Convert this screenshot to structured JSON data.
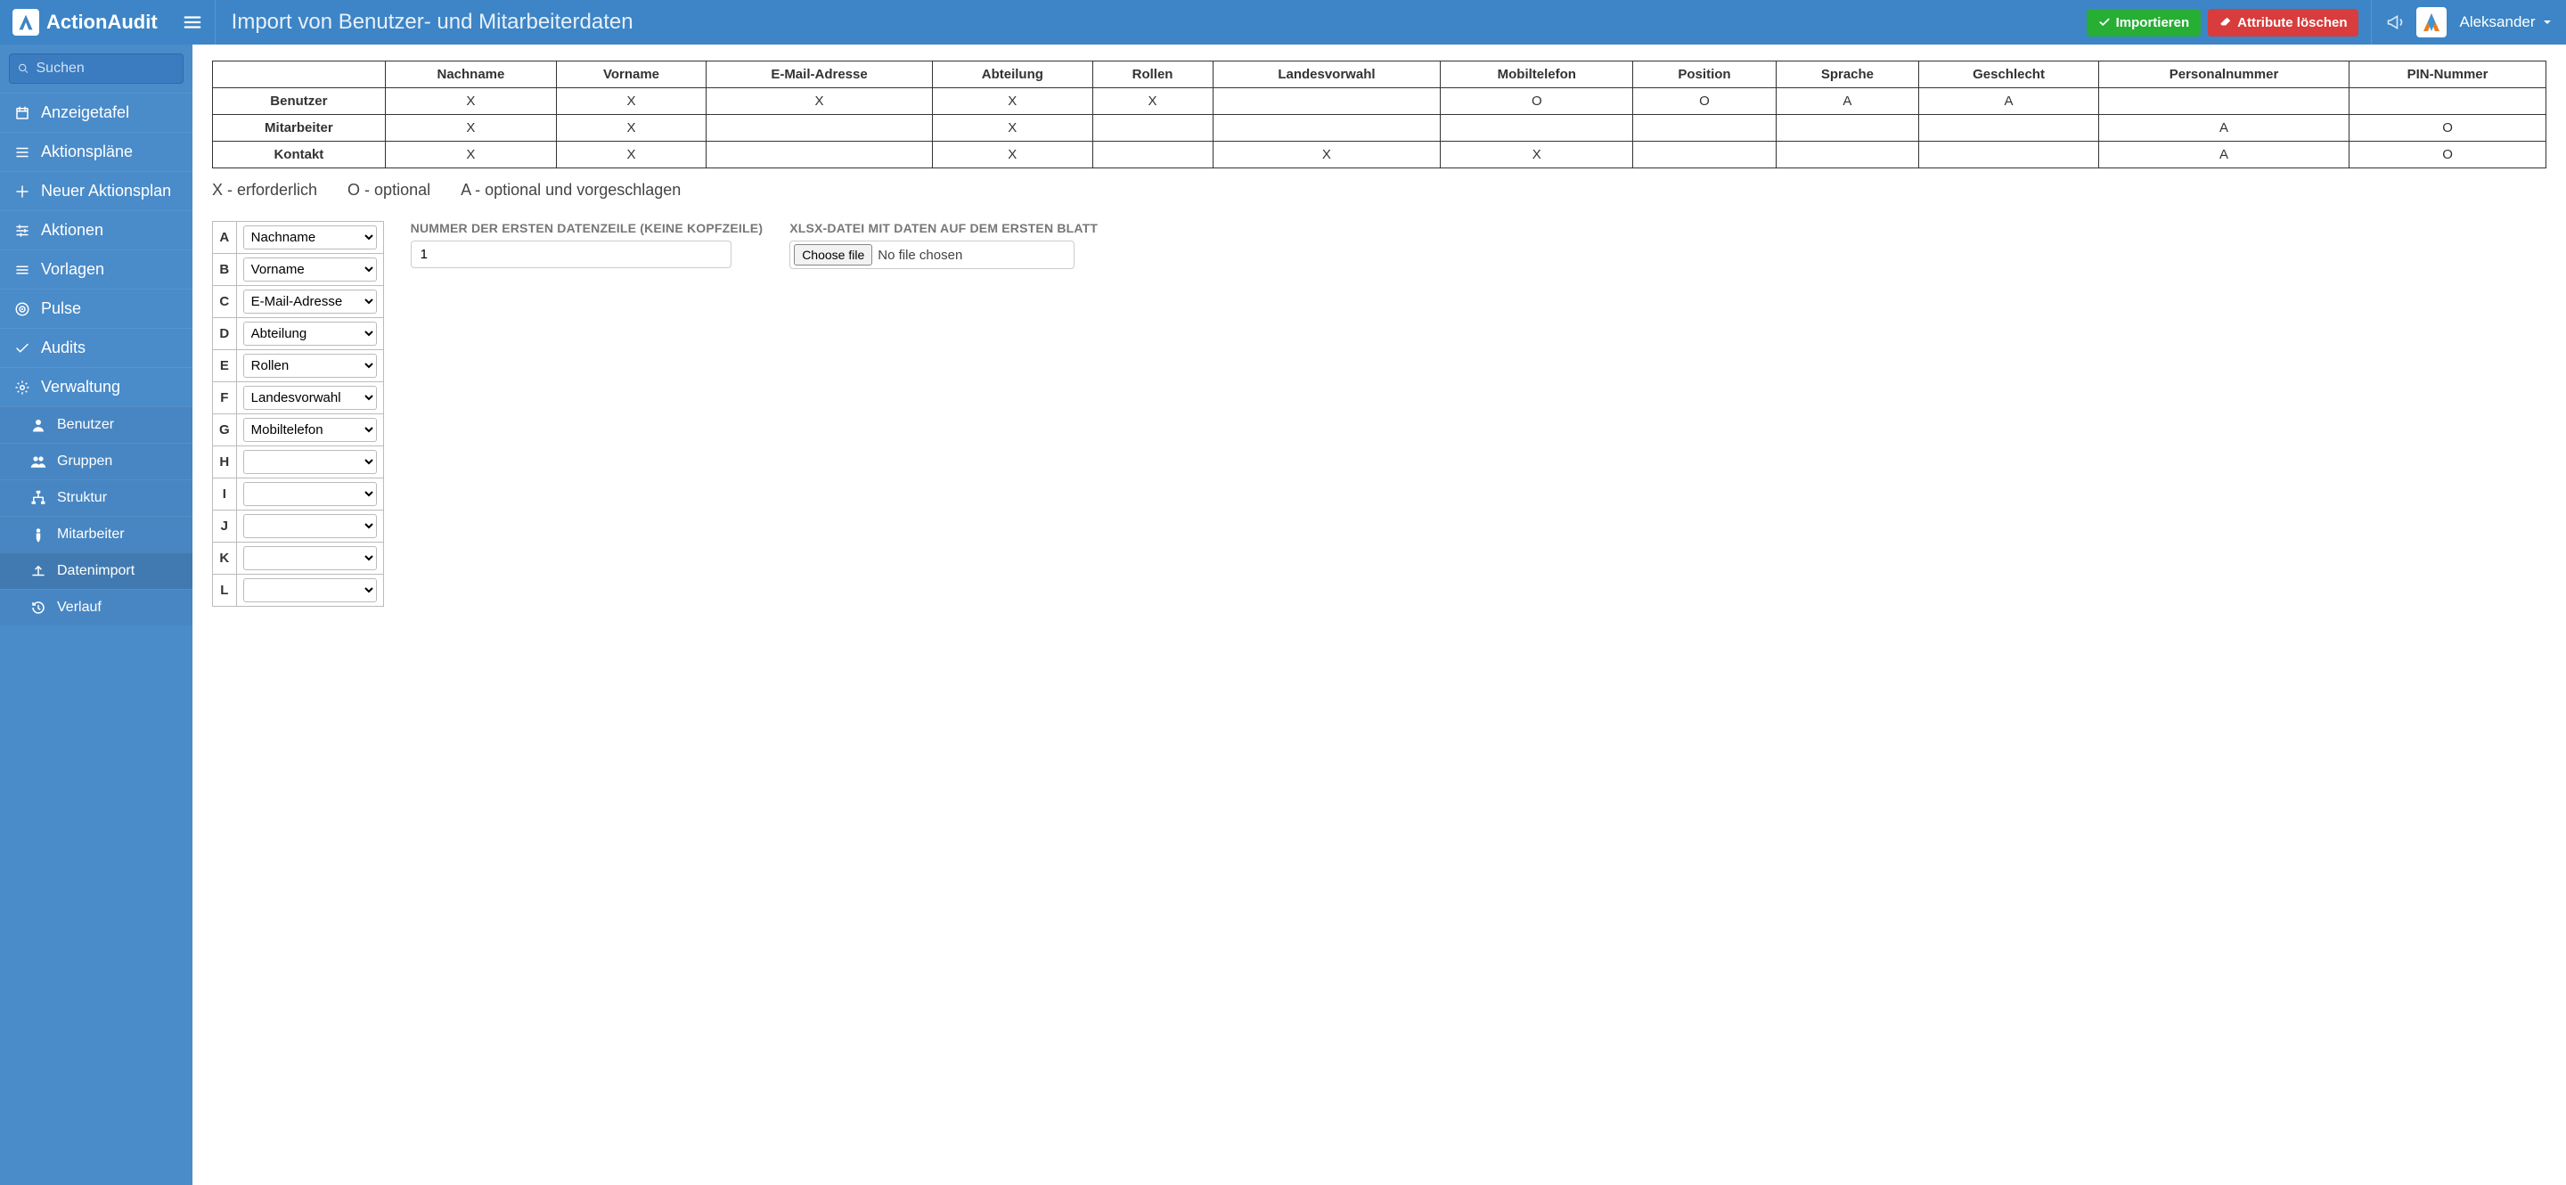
{
  "brand": {
    "name": "ActionAudit"
  },
  "page_title": "Import von Benutzer- und Mitarbeiterdaten",
  "top_actions": {
    "import": "Importieren",
    "clear": "Attribute löschen"
  },
  "user": {
    "name": "Aleksander"
  },
  "search": {
    "placeholder": "Suchen"
  },
  "nav": {
    "items": [
      {
        "label": "Anzeigetafel",
        "icon": "calendar-icon"
      },
      {
        "label": "Aktionspläne",
        "icon": "list-icon"
      },
      {
        "label": "Neuer Aktionsplan",
        "icon": "plus-icon"
      },
      {
        "label": "Aktionen",
        "icon": "sliders-icon"
      },
      {
        "label": "Vorlagen",
        "icon": "menu-icon"
      },
      {
        "label": "Pulse",
        "icon": "target-icon"
      },
      {
        "label": "Audits",
        "icon": "check-icon"
      },
      {
        "label": "Verwaltung",
        "icon": "gear-icon"
      }
    ],
    "children": [
      {
        "label": "Benutzer",
        "icon": "user-icon"
      },
      {
        "label": "Gruppen",
        "icon": "users-icon"
      },
      {
        "label": "Struktur",
        "icon": "sitemap-icon"
      },
      {
        "label": "Mitarbeiter",
        "icon": "person-icon"
      },
      {
        "label": "Datenimport",
        "icon": "upload-icon",
        "active": true
      },
      {
        "label": "Verlauf",
        "icon": "history-icon"
      }
    ]
  },
  "req_table": {
    "columns": [
      "Nachname",
      "Vorname",
      "E-Mail-Adresse",
      "Abteilung",
      "Rollen",
      "Landesvorwahl",
      "Mobiltelefon",
      "Position",
      "Sprache",
      "Geschlecht",
      "Personalnummer",
      "PIN-Nummer"
    ],
    "rows": [
      {
        "label": "Benutzer",
        "cells": [
          "X",
          "X",
          "X",
          "X",
          "X",
          "",
          "O",
          "O",
          "A",
          "A",
          "",
          ""
        ]
      },
      {
        "label": "Mitarbeiter",
        "cells": [
          "X",
          "X",
          "",
          "X",
          "",
          "",
          "",
          "",
          "",
          "",
          "A",
          "O"
        ]
      },
      {
        "label": "Kontakt",
        "cells": [
          "X",
          "X",
          "",
          "X",
          "",
          "X",
          "X",
          "",
          "",
          "",
          "A",
          "O"
        ]
      }
    ]
  },
  "legend": {
    "x": "X - erforderlich",
    "o": "O - optional",
    "a": "A - optional und vorgeschlagen"
  },
  "mapping": {
    "options": [
      "",
      "Nachname",
      "Vorname",
      "E-Mail-Adresse",
      "Abteilung",
      "Rollen",
      "Landesvorwahl",
      "Mobiltelefon",
      "Position",
      "Sprache",
      "Geschlecht",
      "Personalnummer",
      "PIN-Nummer"
    ],
    "rows": [
      {
        "letter": "A",
        "value": "Nachname"
      },
      {
        "letter": "B",
        "value": "Vorname"
      },
      {
        "letter": "C",
        "value": "E-Mail-Adresse"
      },
      {
        "letter": "D",
        "value": "Abteilung"
      },
      {
        "letter": "E",
        "value": "Rollen"
      },
      {
        "letter": "F",
        "value": "Landesvorwahl"
      },
      {
        "letter": "G",
        "value": "Mobiltelefon"
      },
      {
        "letter": "H",
        "value": ""
      },
      {
        "letter": "I",
        "value": ""
      },
      {
        "letter": "J",
        "value": ""
      },
      {
        "letter": "K",
        "value": ""
      },
      {
        "letter": "L",
        "value": ""
      }
    ]
  },
  "first_row": {
    "label": "NUMMER DER ERSTEN DATENZEILE (KEINE KOPFZEILE)",
    "value": "1"
  },
  "file": {
    "label": "XLSX-DATEI MIT DATEN AUF DEM ERSTEN BLATT",
    "button": "Choose file",
    "placeholder": "No file chosen"
  }
}
